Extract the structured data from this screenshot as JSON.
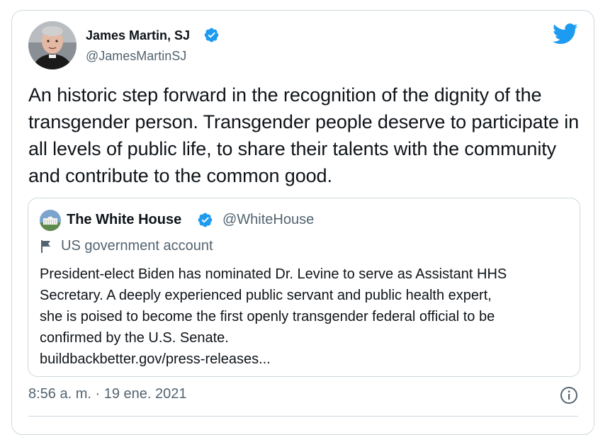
{
  "tweet": {
    "author": {
      "name": "James Martin, SJ",
      "handle": "@JamesMartinSJ",
      "verified": true,
      "avatar_icon": "profile-photo"
    },
    "text": "An historic step forward in the recognition of the dignity of the transgender person. Transgender people deserve to participate in all levels of public life, to share their talents with the community and contribute to the common good.",
    "timestamp": "8:56 a. m. · 19 ene. 2021",
    "brand_icon": "twitter-bird-icon",
    "info_icon": "info-icon"
  },
  "quoted_tweet": {
    "author": {
      "name": "The White House",
      "handle": "@WhiteHouse",
      "verified": true,
      "avatar_icon": "white-house-photo"
    },
    "label": "US government account",
    "label_icon": "flag-icon",
    "text_lines": [
      "President-elect Biden has nominated Dr. Levine to serve as Assistant HHS",
      "Secretary. A deeply experienced public servant and public health expert,",
      "she is poised to become the first openly transgender federal official to be",
      "confirmed by the U.S. Senate.",
      "buildbackbetter.gov/press-releases..."
    ]
  },
  "colors": {
    "twitter_blue": "#1d9bf0",
    "text_primary": "#0f1419",
    "text_secondary": "#536471",
    "border": "#cfd9de"
  }
}
